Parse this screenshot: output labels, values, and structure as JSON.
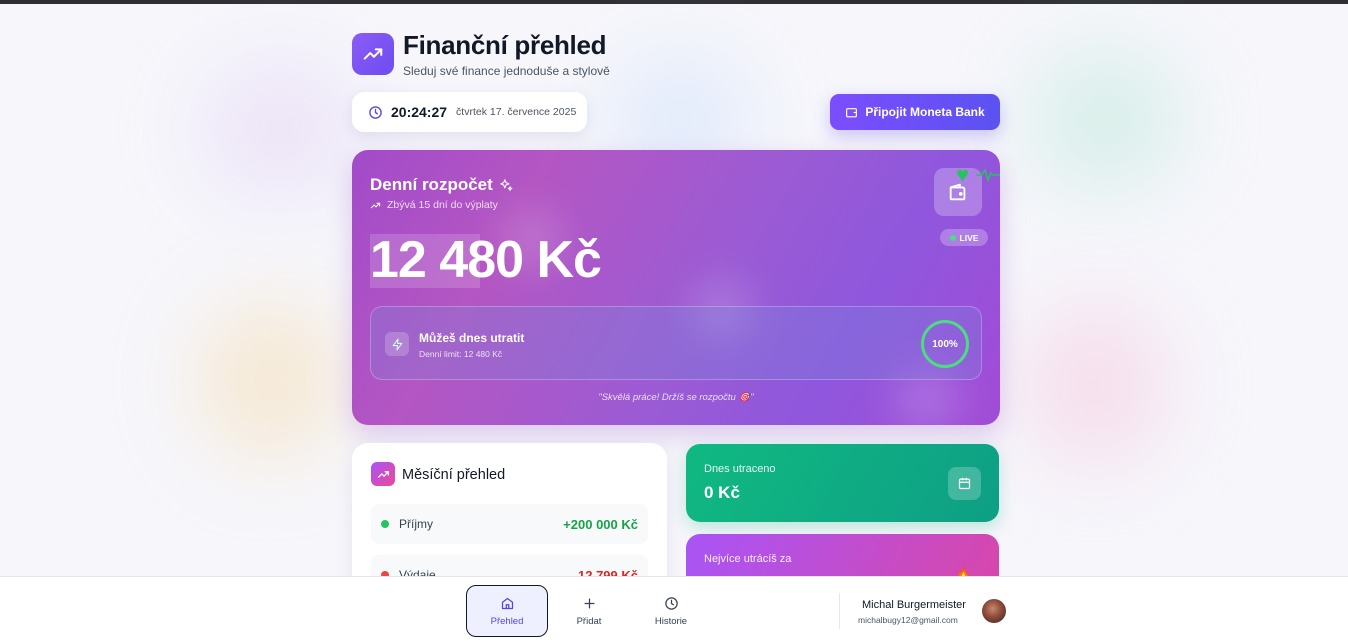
{
  "header": {
    "title": "Finanční přehled",
    "subtitle": "Sleduj své finance jednoduše a stylově",
    "logo_icon": "trending-up-icon"
  },
  "clock": {
    "time": "20:24:27",
    "date": "čtvrtek 17. července 2025"
  },
  "connect_button": {
    "label": "Připojit Moneta Bank",
    "icon": "wallet-icon"
  },
  "budget": {
    "title": "Denní rozpočet",
    "days_left": "Zbývá 15 dní do výplaty",
    "amount": "12 480 Kč",
    "live_label": "LIVE",
    "spend_title": "Můžeš dnes utratit",
    "spend_limit": "Denní limit: 12 480 Kč",
    "progress_label": "100%",
    "progress_fraction": 1.0,
    "quote": "\"Skvělá práce! Držíš se rozpočtu 🎯\""
  },
  "monthly": {
    "title": "Měsíční přehled",
    "rows": [
      {
        "label": "Příjmy",
        "value": "+200 000 Kč",
        "color": "#16a34a"
      },
      {
        "label": "Výdaje",
        "value": "12 799 Kč",
        "color": "#dc2626"
      }
    ]
  },
  "today": {
    "label": "Dnes utraceno",
    "value": "0 Kč"
  },
  "most": {
    "label": "Nejvíce utrácíš za"
  },
  "nav": {
    "items": [
      {
        "label": "Přehled",
        "icon": "home-icon"
      },
      {
        "label": "Přidat",
        "icon": "plus-icon"
      },
      {
        "label": "Historie",
        "icon": "clock-icon"
      }
    ]
  },
  "user": {
    "name": "Michal Burgermeister",
    "email": "michalbugy12@gmail.com"
  },
  "colors": {
    "accent": "#6d4cf0",
    "income": "#16a34a",
    "expense": "#dc2626",
    "green_card": "#10b981"
  }
}
